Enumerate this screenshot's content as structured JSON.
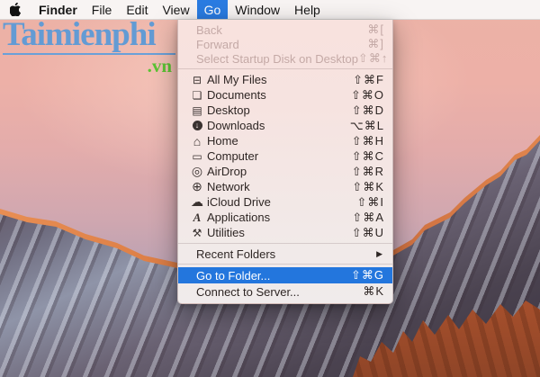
{
  "menubar": {
    "apple_icon": "apple-logo",
    "items": [
      {
        "label": "Finder",
        "bold": true
      },
      {
        "label": "File"
      },
      {
        "label": "Edit"
      },
      {
        "label": "View"
      },
      {
        "label": "Go",
        "active": true
      },
      {
        "label": "Window"
      },
      {
        "label": "Help"
      }
    ]
  },
  "watermark": {
    "title": "Taimienphi",
    "suffix": ".vn",
    "title_color": "#639bd4",
    "suffix_color": "#5cc433"
  },
  "go_menu": {
    "sections": [
      {
        "name": "history",
        "items": [
          {
            "label": "Back",
            "shortcut": "⌘[",
            "disabled": true
          },
          {
            "label": "Forward",
            "shortcut": "⌘]",
            "disabled": true
          },
          {
            "label": "Select Startup Disk on Desktop",
            "shortcut": "⇧⌘↑",
            "disabled": true
          }
        ]
      },
      {
        "name": "places",
        "items": [
          {
            "icon": "all-my-files-icon",
            "glyph": "⊟",
            "label": "All My Files",
            "shortcut": "⇧⌘F"
          },
          {
            "icon": "documents-icon",
            "glyph": "❏",
            "label": "Documents",
            "shortcut": "⇧⌘O"
          },
          {
            "icon": "desktop-icon",
            "glyph": "▤",
            "label": "Desktop",
            "shortcut": "⇧⌘D"
          },
          {
            "icon": "downloads-icon",
            "glyph": "↓",
            "circle": true,
            "label": "Downloads",
            "shortcut": "⌥⌘L"
          },
          {
            "icon": "home-icon",
            "glyph": "⌂",
            "big": true,
            "label": "Home",
            "shortcut": "⇧⌘H"
          },
          {
            "icon": "computer-icon",
            "glyph": "▭",
            "label": "Computer",
            "shortcut": "⇧⌘C"
          },
          {
            "icon": "airdrop-icon",
            "glyph": "◎",
            "big": true,
            "label": "AirDrop",
            "shortcut": "⇧⌘R"
          },
          {
            "icon": "network-icon",
            "glyph": "⊕",
            "big": true,
            "label": "Network",
            "shortcut": "⇧⌘K"
          },
          {
            "icon": "icloud-drive-icon",
            "glyph": "☁",
            "big": true,
            "label": "iCloud Drive",
            "shortcut": "⇧⌘I"
          },
          {
            "icon": "applications-icon",
            "glyph": "A",
            "letter": true,
            "label": "Applications",
            "shortcut": "⇧⌘A"
          },
          {
            "icon": "utilities-icon",
            "glyph": "⚒",
            "label": "Utilities",
            "shortcut": "⇧⌘U"
          }
        ]
      },
      {
        "name": "recent",
        "items": [
          {
            "label": "Recent Folders",
            "submenu": "▶"
          }
        ]
      },
      {
        "name": "actions",
        "items": [
          {
            "label": "Go to Folder...",
            "shortcut": "⇧⌘G",
            "highlighted": true
          },
          {
            "label": "Connect to Server...",
            "shortcut": "⌘K"
          }
        ]
      }
    ]
  },
  "colors": {
    "menu_highlight": "#2376dd",
    "menubar_active": "#2a7ce2",
    "menubar_bg": "#f8f4f3",
    "menu_panel_bg": "#f5e4e1",
    "disabled_text": "#c4a9a6",
    "sky_top": "#ecb2a6",
    "rock_dark": "#3a3340",
    "sunlit_orange": "#d9713c"
  }
}
